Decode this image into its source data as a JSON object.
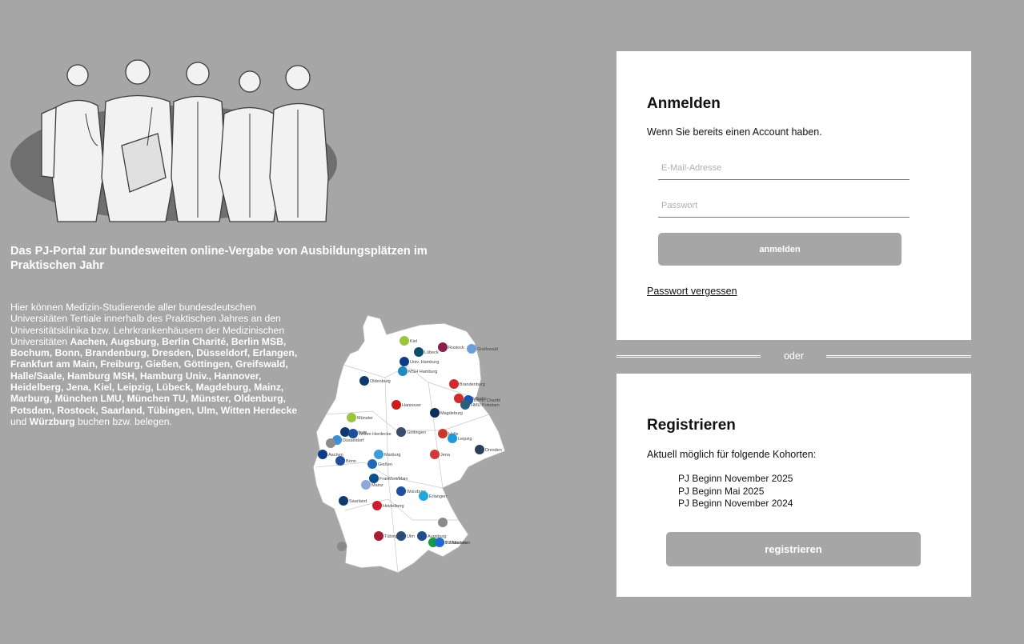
{
  "intro": {
    "headline": "Das PJ-Portal zur bundesweiten online-Vergabe von Ausbildungsplätzen im Praktischen Jahr",
    "text_prefix": "Hier können Medizin-Studierende aller bundesdeutschen Universitäten Tertiale innerhalb des Praktischen Jahres an den Universitätsklinika bzw. Lehrkrankenhäusern der Medizinischen Universitäten ",
    "universities": "Aachen, Augsburg, Berlin Charité, Berlin MSB, Bochum, Bonn, Brandenburg, Dresden, Düsseldorf, Erlangen, Frankfurt am Main, Freiburg, Gießen, Göttingen, Greifswald, Halle/Saale, Hamburg MSH, Hamburg Univ., Hannover, Heidelberg, Jena, Kiel, Leipzig, Lübeck, Magdeburg, Mainz, Marburg, München LMU, München TU, Münster, Oldenburg, Potsdam, Rostock, Saarland, Tübingen, Ulm, Witten Herdecke",
    "text_und": " und ",
    "last_university": "Würzburg",
    "text_suffix": " buchen bzw. belegen."
  },
  "map": {
    "cities": [
      {
        "label": "Kiel",
        "color": "#9bc53d"
      },
      {
        "label": "Lübeck",
        "color": "#0b4f6c"
      },
      {
        "label": "Greifswald",
        "color": "#6a9fd8"
      },
      {
        "label": "Rostock",
        "color": "#8b1e4f"
      },
      {
        "label": "Univ. Hamburg",
        "color": "#0d3b85"
      },
      {
        "label": "MSH Hamburg",
        "color": "#1f8ac0"
      },
      {
        "label": "Oldenburg",
        "color": "#0d3b6e"
      },
      {
        "label": "Brandenburg",
        "color": "#d12a2a"
      },
      {
        "label": "MSB Berlin",
        "color": "#d12a2a"
      },
      {
        "label": "Berlin Charité",
        "color": "#1a56b0"
      },
      {
        "label": "HMU Potsdam",
        "color": "#2a5f7a"
      },
      {
        "label": "Hannover",
        "color": "#c81e1e"
      },
      {
        "label": "Magdeburg",
        "color": "#0d2f5e"
      },
      {
        "label": "Münster",
        "color": "#9bc53d"
      },
      {
        "label": "Bochum",
        "color": "#0d3b6e"
      },
      {
        "label": "Witten Herdecke",
        "color": "#1f4e9c"
      },
      {
        "label": "Düsseldorf",
        "color": "#3a8fd8"
      },
      {
        "label": "Göttingen",
        "color": "#3a4a6a"
      },
      {
        "label": "Halle",
        "color": "#c8392b"
      },
      {
        "label": "Leipzig",
        "color": "#1e9ad6"
      },
      {
        "label": "Dresden",
        "color": "#2b3f5c"
      },
      {
        "label": "Aachen",
        "color": "#0d3b85"
      },
      {
        "label": "Bonn",
        "color": "#1f4e9c"
      },
      {
        "label": "Marburg",
        "color": "#3a9fd8"
      },
      {
        "label": "Gießen",
        "color": "#1f6ab0"
      },
      {
        "label": "Jena",
        "color": "#d13a3a"
      },
      {
        "label": "Frankfurt/Main",
        "color": "#0b4f8c"
      },
      {
        "label": "Mainz",
        "color": "#8fa8d8"
      },
      {
        "label": "Würzburg",
        "color": "#1f4e9c"
      },
      {
        "label": "Erlangen",
        "color": "#1fa8e0"
      },
      {
        "label": "Saarland",
        "color": "#0d3b6e"
      },
      {
        "label": "Heidelberg",
        "color": "#c81e2e"
      },
      {
        "label": "Ulm",
        "color": "#2b4f7a"
      },
      {
        "label": "Augsburg",
        "color": "#1f4e8c"
      },
      {
        "label": "LMU München",
        "color": "#139a43"
      },
      {
        "label": "TU München",
        "color": "#1f6ad0"
      },
      {
        "label": "Tübingen",
        "color": "#a51e36"
      }
    ]
  },
  "login": {
    "title": "Anmelden",
    "subtitle": "Wenn Sie bereits einen Account haben.",
    "email_placeholder": "E-Mail-Adresse",
    "password_placeholder": "Passwort",
    "submit_label": "anmelden",
    "forgot_label": "Passwort vergessen"
  },
  "divider": {
    "label": "oder"
  },
  "register": {
    "title": "Registrieren",
    "subtitle": "Aktuell möglich für folgende Kohorten:",
    "cohorts": [
      "PJ Beginn November 2025",
      "PJ Beginn Mai 2025",
      "PJ Beginn November 2024"
    ],
    "submit_label": "registrieren"
  },
  "colors": {
    "background": "#a6a6a6",
    "card": "#ffffff",
    "button": "#a6a6a6"
  }
}
